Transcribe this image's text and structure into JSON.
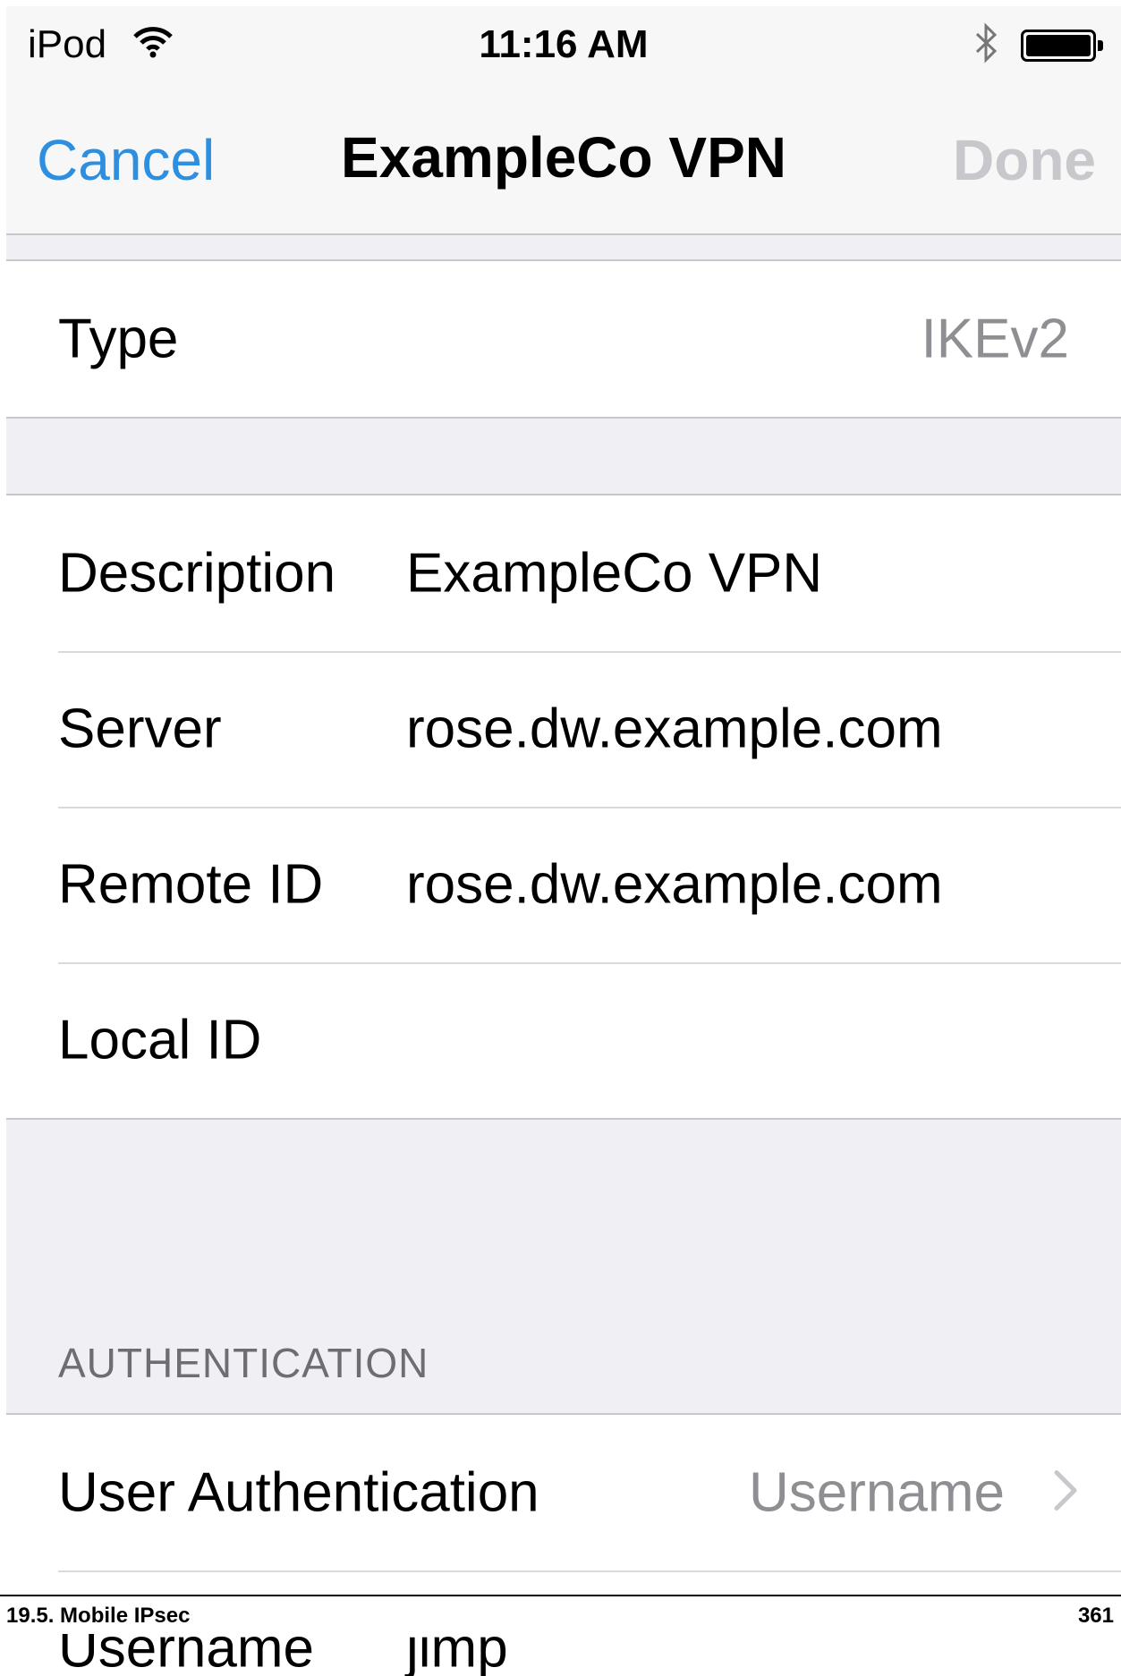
{
  "status_bar": {
    "carrier": "iPod",
    "time": "11:16 AM",
    "icons": [
      "wifi-icon",
      "bluetooth-icon",
      "battery-icon"
    ],
    "battery_level": 1.0
  },
  "nav": {
    "cancel": "Cancel",
    "title": "ExampleCo VPN",
    "done": "Done"
  },
  "type_row": {
    "label": "Type",
    "value": "IKEv2"
  },
  "config_rows": {
    "description": {
      "label": "Description",
      "value": "ExampleCo VPN"
    },
    "server": {
      "label": "Server",
      "value": "rose.dw.example.com"
    },
    "remote_id": {
      "label": "Remote ID",
      "value": "rose.dw.example.com"
    },
    "local_id": {
      "label": "Local ID",
      "value": ""
    }
  },
  "authentication": {
    "header": "AUTHENTICATION",
    "user_auth": {
      "label": "User Authentication",
      "value": "Username"
    },
    "username": {
      "label": "Username",
      "value": "jimp"
    }
  },
  "page_footer": {
    "section": "19.5. Mobile IPsec",
    "page": "361"
  },
  "colors": {
    "accent": "#2e8fe0",
    "disabled": "#c7c7cc",
    "secondary_text": "#8e8e93",
    "grouped_background": "#efeff4"
  }
}
